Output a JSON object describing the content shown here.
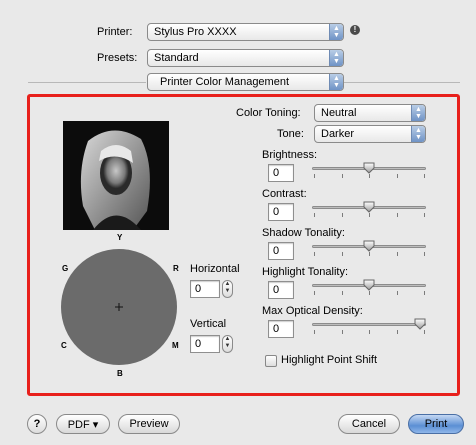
{
  "top": {
    "printer_label": "Printer:",
    "printer_value": "Stylus Pro XXXX",
    "presets_label": "Presets:",
    "presets_value": "Standard",
    "section_value": "Printer Color Management"
  },
  "panel": {
    "color_toning_label": "Color Toning:",
    "color_toning_value": "Neutral",
    "tone_label": "Tone:",
    "tone_value": "Darker",
    "sliders": [
      {
        "label": "Brightness:",
        "value": "0",
        "level": 0.5
      },
      {
        "label": "Contrast:",
        "value": "0",
        "level": 0.5
      },
      {
        "label": "Shadow Tonality:",
        "value": "0",
        "level": 0.5
      },
      {
        "label": "Highlight Tonality:",
        "value": "0",
        "level": 0.5
      },
      {
        "label": "Max Optical Density:",
        "value": "0",
        "level": 1.0
      }
    ],
    "highlight_point_shift": "Highlight Point Shift",
    "color_wheel": {
      "labels": {
        "y": "Y",
        "r": "R",
        "m": "M",
        "b": "B",
        "c": "C",
        "g": "G"
      },
      "crosshair": "+"
    },
    "horizontal_label": "Horizontal",
    "horizontal_value": "0",
    "vertical_label": "Vertical",
    "vertical_value": "0"
  },
  "bottom": {
    "help": "?",
    "pdf": "PDF ▾",
    "preview": "Preview",
    "cancel": "Cancel",
    "print": "Print"
  },
  "colors": {
    "panel_border": "#e8201c",
    "wheel_gray": "#6b6b6b",
    "default_button": "#5b8fd4"
  }
}
